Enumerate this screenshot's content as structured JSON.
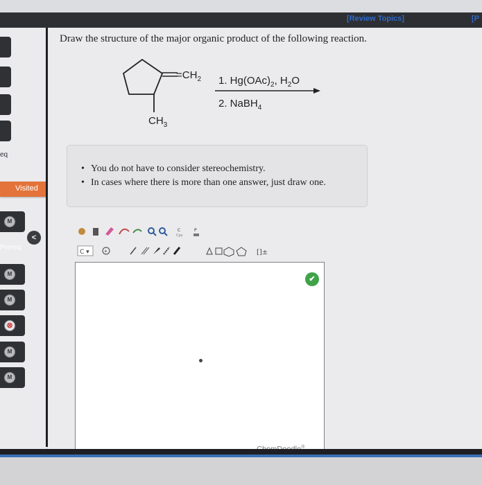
{
  "header": {
    "review_topics": "[Review Topics]",
    "corner_text": "[P"
  },
  "sidebar": {
    "labels": [
      "eq",
      "Visited",
      "Prereq"
    ],
    "badges": [
      "M",
      "M",
      "M",
      "⊗",
      "M",
      "M"
    ],
    "collapse_icon": "<"
  },
  "question": {
    "text": "Draw the structure of the major organic product of the following reaction."
  },
  "reaction": {
    "substituent_top": "=CH",
    "substituent_top_sub": "2",
    "substituent_bottom": "CH",
    "substituent_bottom_sub": "3",
    "step1_prefix": "1. Hg(OAc)",
    "step1_sub1": "2",
    "step1_mid": ", H",
    "step1_sub2": "2",
    "step1_suffix": "O",
    "step2_prefix": "2. NaBH",
    "step2_sub": "4"
  },
  "notes": {
    "items": [
      "You do not have to consider stereochemistry.",
      "In cases where there is more than one answer, just draw one."
    ]
  },
  "editor": {
    "atom_label": "C",
    "brand": "ChemDoodle",
    "brand_mark": "®"
  },
  "colors": {
    "link": "#2f69c7",
    "visited": "#e3733a",
    "check": "#40a34a"
  }
}
